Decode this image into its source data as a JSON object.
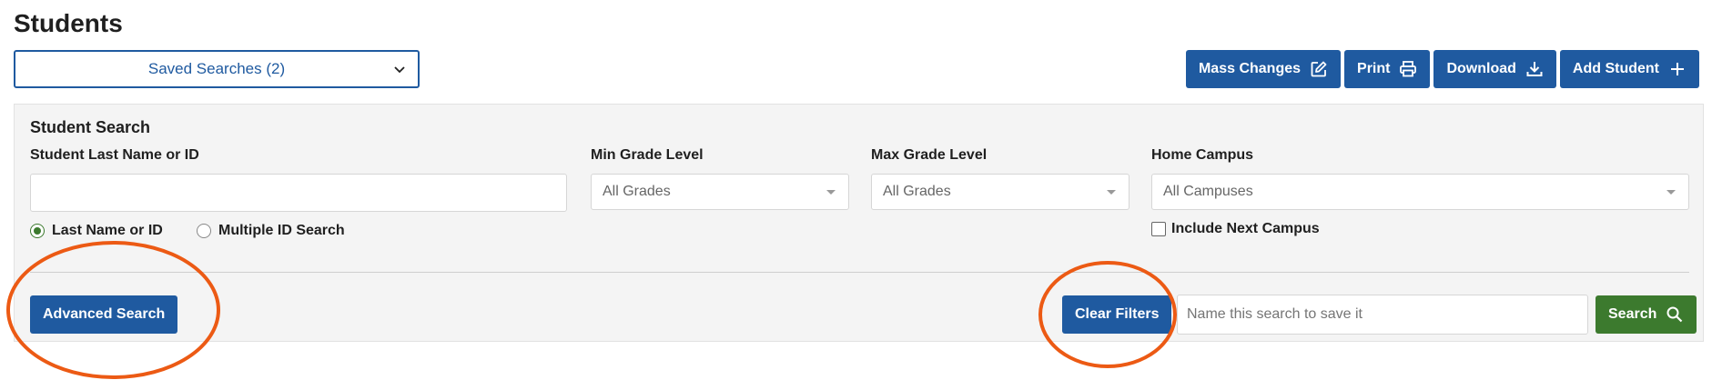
{
  "page": {
    "title": "Students"
  },
  "saved_searches": {
    "label": "Saved Searches (2)",
    "icon": "chevron-down-icon"
  },
  "actions": {
    "mass_changes": {
      "label": "Mass Changes",
      "icon": "edit-icon"
    },
    "print": {
      "label": "Print",
      "icon": "printer-icon"
    },
    "download": {
      "label": "Download",
      "icon": "download-icon"
    },
    "add_student": {
      "label": "Add Student",
      "icon": "plus-icon"
    }
  },
  "search_panel": {
    "title": "Student Search",
    "last_name_label": "Student Last Name or ID",
    "last_name_value": "",
    "radio_options": [
      {
        "label": "Last Name or ID",
        "checked": true
      },
      {
        "label": "Multiple ID Search",
        "checked": false
      }
    ],
    "min_grade": {
      "label": "Min Grade Level",
      "value": "All Grades"
    },
    "max_grade": {
      "label": "Max Grade Level",
      "value": "All Grades"
    },
    "home_campus": {
      "label": "Home Campus",
      "value": "All Campuses"
    },
    "include_next_campus": {
      "label": "Include Next Campus",
      "checked": false
    },
    "advanced_search_label": "Advanced Search",
    "clear_filters_label": "Clear Filters",
    "save_search_placeholder": "Name this search to save it",
    "search_button": {
      "label": "Search",
      "icon": "search-icon"
    }
  },
  "colors": {
    "primary": "#1f5aa0",
    "success": "#3c7a2e",
    "annotation": "#ec5a14",
    "panel_bg": "#f4f4f4"
  }
}
